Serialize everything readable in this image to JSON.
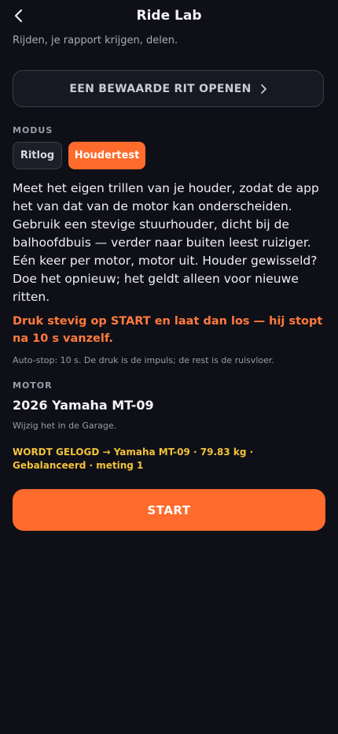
{
  "header": {
    "title": "Ride Lab",
    "back_icon": "chevron-left-icon"
  },
  "subtitle": "Rijden, je rapport krijgen, delen.",
  "open_saved": {
    "label": "EEN BEWAARDE RIT OPENEN",
    "icon": "chevron-right-icon"
  },
  "mode": {
    "label": "MODUS",
    "tabs": [
      {
        "label": "Ritlog",
        "active": false
      },
      {
        "label": "Houdertest",
        "active": true
      }
    ]
  },
  "description": "Meet het eigen trillen van je houder, zodat de app het van dat van de motor kan onderscheiden. Gebruik een stevige stuurhouder, dicht bij de balhoofdbuis — verder naar buiten leest ruiziger. Eén keer per motor, motor uit. Houder gewisseld? Doe het opnieuw; het geldt alleen voor nieuwe ritten.",
  "instruction": "Druk stevig op START en laat dan los — hij stopt na 10 s vanzelf.",
  "hint": "Auto-stop: 10 s. De druk is de impuls; de rest is de ruisvloer.",
  "motor": {
    "label": "MOTOR",
    "name": "2026 Yamaha MT-09",
    "garage_hint": "Wijzig het in de Garage.",
    "logged": "WORDT GELOGD → Yamaha MT-09 · 79.83 kg · Gebalanceerd · meting 1"
  },
  "start_button": {
    "label": "START"
  },
  "colors": {
    "background": "#0f1017",
    "accent": "#ff6b2c",
    "instruction": "#ff7a3d",
    "logged": "#f2c23a"
  }
}
